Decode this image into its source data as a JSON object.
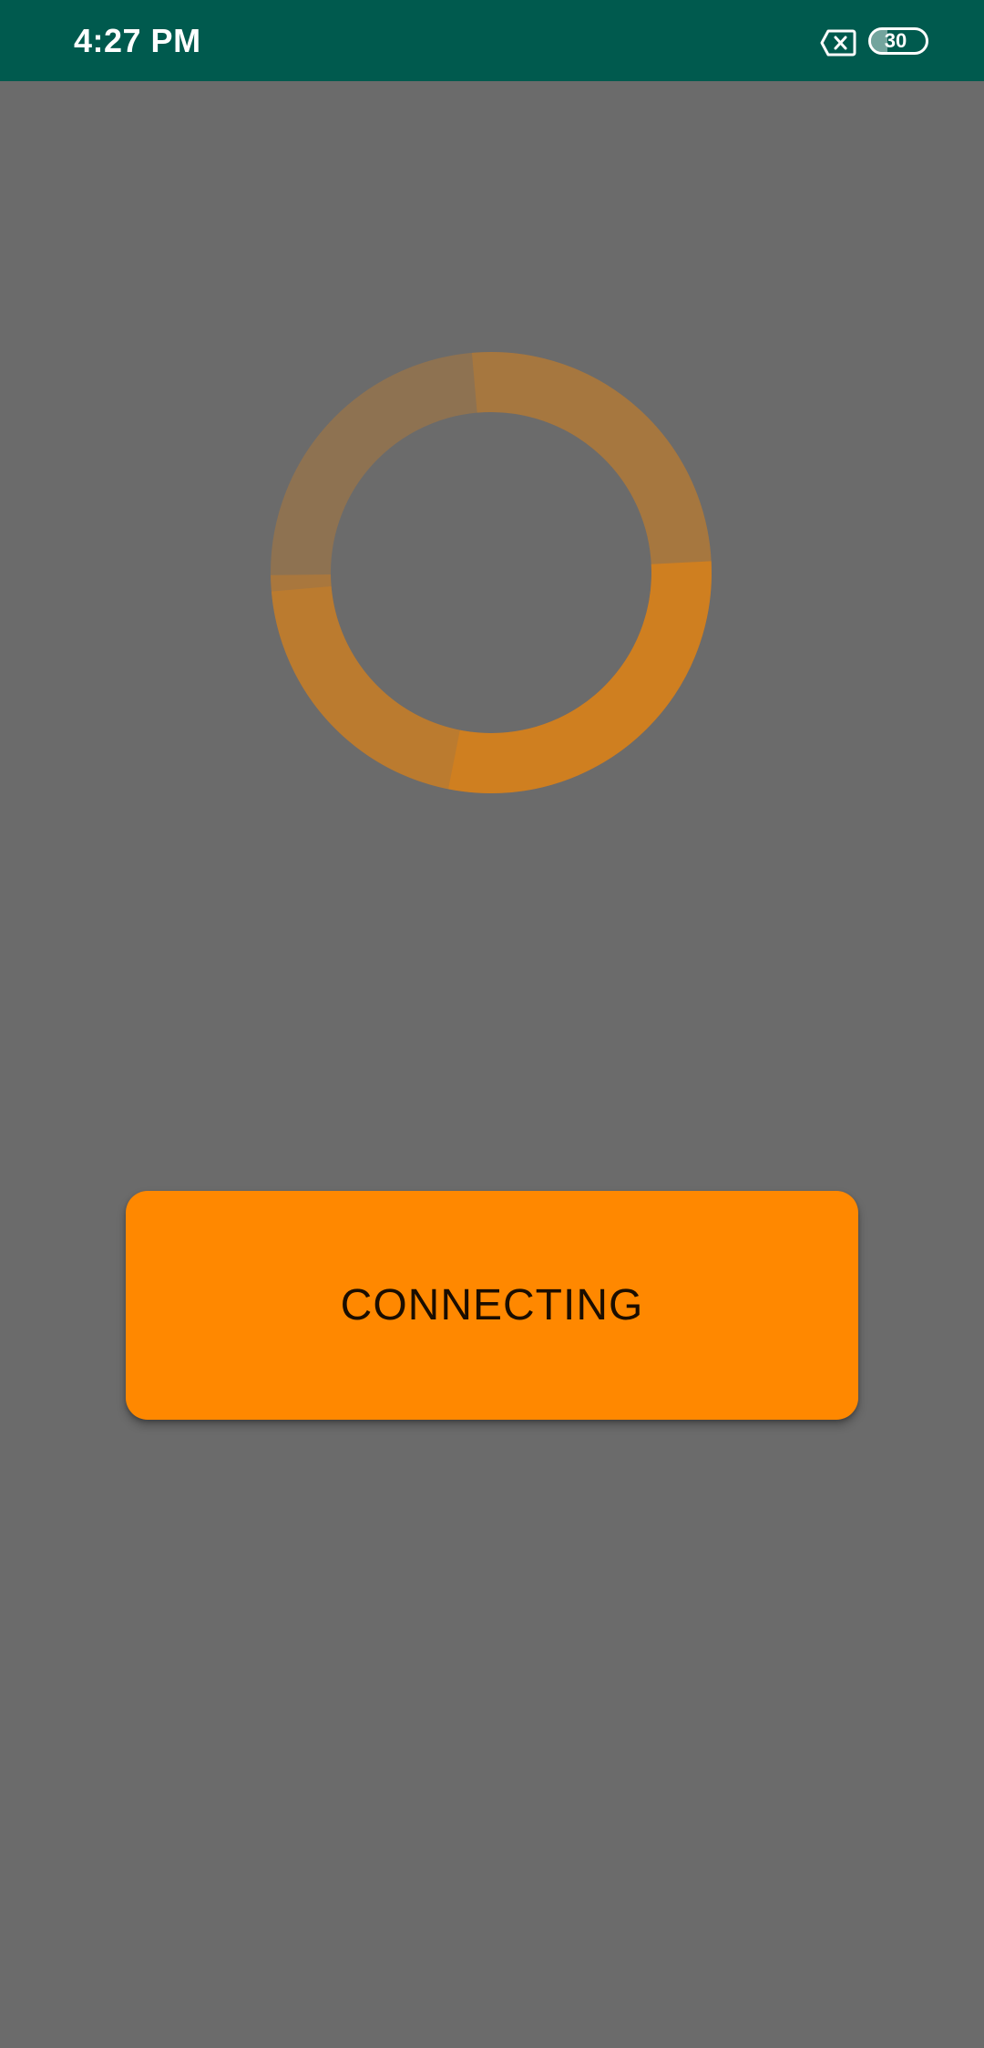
{
  "status_bar": {
    "time": "4:27 PM",
    "sim_icon": "sim-error-icon",
    "battery_level": "30",
    "battery_fraction": 0.3,
    "background_color": "#005a4e"
  },
  "spinner": {
    "icon": "loading-spinner-icon",
    "color": "#ff8800"
  },
  "main": {
    "background_color": "#6b6b6b",
    "button": {
      "label": "CONNECTING",
      "color": "#ff8800",
      "text_color": "#1a0d00"
    }
  }
}
